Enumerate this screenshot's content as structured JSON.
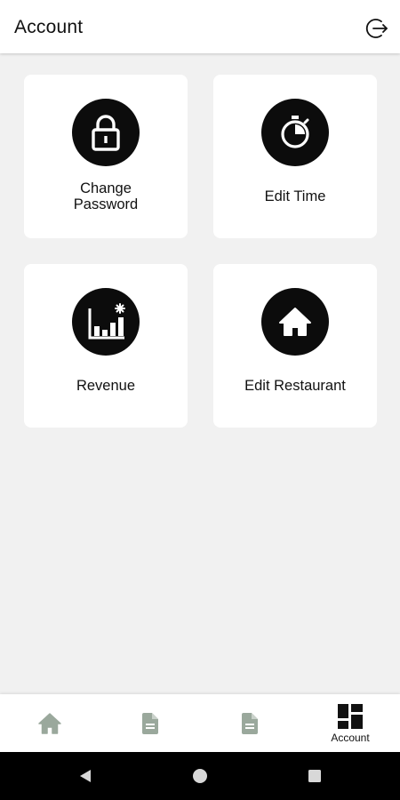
{
  "header": {
    "title": "Account",
    "logout_icon": "logout-icon"
  },
  "cards": [
    {
      "label_line1": "Change",
      "label_line2": "Password",
      "icon": "lock-icon"
    },
    {
      "label": "Edit Time",
      "icon": "stopwatch-icon"
    },
    {
      "label": "Revenue",
      "icon": "bar-chart-icon"
    },
    {
      "label": "Edit Restaurant",
      "icon": "home-icon"
    }
  ],
  "bottom_nav": {
    "items": [
      {
        "icon": "home-icon",
        "label": ""
      },
      {
        "icon": "document-icon",
        "label": ""
      },
      {
        "icon": "document-icon",
        "label": ""
      },
      {
        "icon": "dashboard-icon",
        "label": "Account",
        "active": true
      }
    ]
  },
  "system_nav": {
    "back": "back-icon",
    "home": "home-circle-icon",
    "recents": "recents-icon"
  },
  "colors": {
    "background": "#f1f1f1",
    "card": "#ffffff",
    "icon_circle": "#0c0c0c",
    "nav_inactive": "#9aa89c",
    "nav_active": "#111111"
  }
}
